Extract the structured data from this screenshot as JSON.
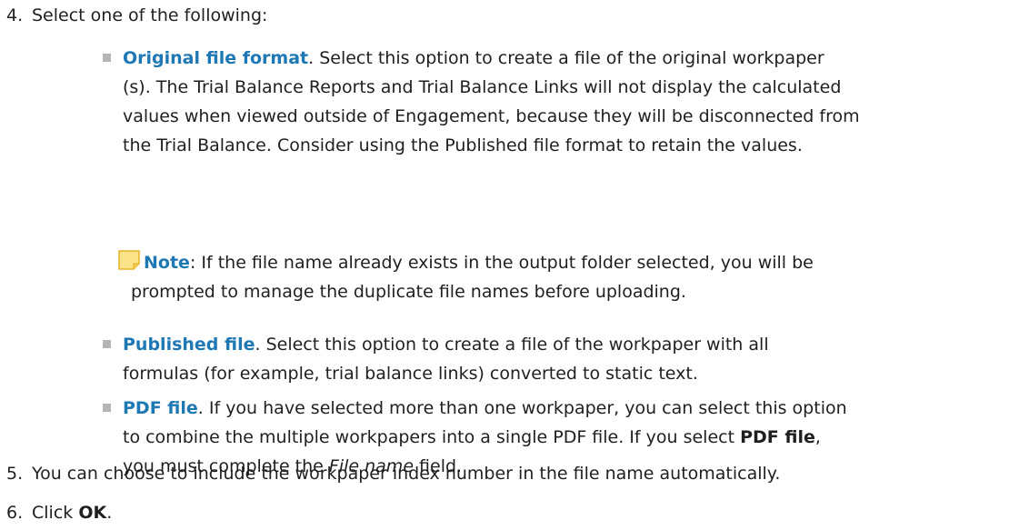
{
  "step4": {
    "number": "4.",
    "text": "Select one of the following:"
  },
  "options": [
    {
      "term": "Original file format",
      "lines": [
        ". Select this option to create a file of the original workpaper",
        "(s). The Trial Balance Reports and Trial Balance Links will not display the calculated",
        "values when viewed outside of Engagement, because they will be disconnected from",
        "the Trial Balance. Consider using the Published file format to retain the values."
      ]
    },
    {
      "term": "Published file",
      "lines": [
        ". Select this option to create a file of the workpaper with all",
        "formulas (for example, trial balance links) converted to static text."
      ]
    },
    {
      "term": "PDF file",
      "lines": [
        ". If you have selected more than one workpaper, you can select this option",
        "to combine the multiple workpapers into a single PDF file. If you select "
      ],
      "bold_inline": "PDF file",
      "line3_pre": ",",
      "line4_pre": "you must complete the ",
      "italic": "File name",
      "line4_post": "  field."
    }
  ],
  "note": {
    "label": "Note",
    "lines": [
      ": If the file name already exists in the output folder selected, you will be",
      "prompted to manage the duplicate file names before uploading."
    ],
    "icon_color": "#f0c419"
  },
  "step5": {
    "number": "5.",
    "text": "You can choose to include the workpaper index number in the file name automatically."
  },
  "step6": {
    "number": "6.",
    "pre": "Click ",
    "bold": "OK",
    "post": "."
  },
  "colors": {
    "accent": "#1e78b4",
    "bullet": "#b5b5b5"
  }
}
